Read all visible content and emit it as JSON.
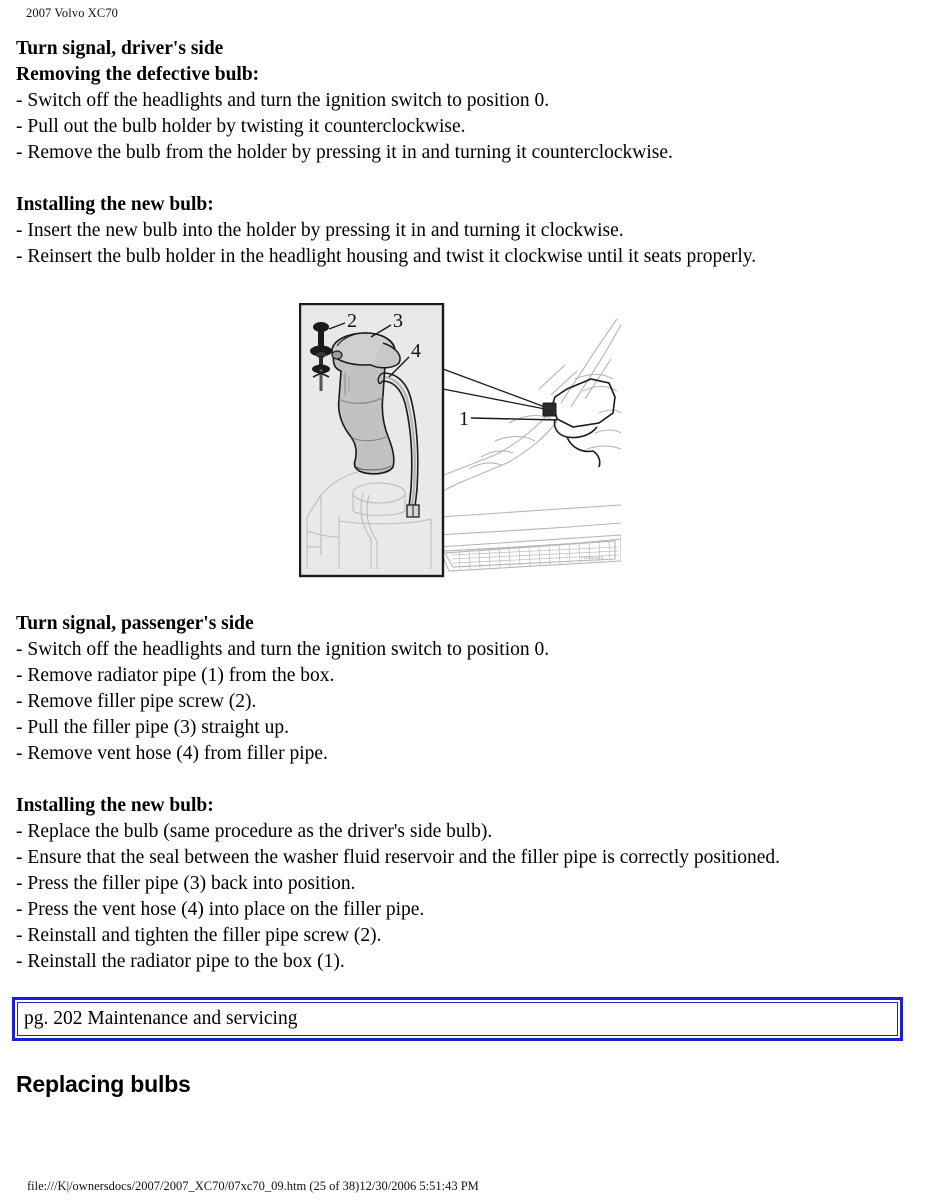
{
  "header": {
    "title": "2007 Volvo XC70"
  },
  "sections": [
    {
      "heading": "Turn signal, driver's side",
      "subheading": "Removing the defective bulb:",
      "items": [
        "- Switch off the headlights and turn the ignition switch to position 0.",
        "- Pull out the bulb holder by twisting it counterclockwise.",
        "- Remove the bulb from the holder by pressing it in and turning it counterclockwise."
      ]
    },
    {
      "heading": "",
      "subheading": "Installing the new bulb:",
      "items": [
        "- Insert the new bulb into the holder by pressing it in and turning it clockwise.",
        "- Reinsert the bulb holder in the headlight housing and twist it clockwise until it seats properly."
      ]
    },
    {
      "heading": "Turn signal, passenger's side",
      "subheading": "",
      "items": [
        "- Switch off the headlights and turn the ignition switch to position 0.",
        "- Remove radiator pipe (1) from the box.",
        "- Remove filler pipe screw (2).",
        "- Pull the filler pipe (3) straight up.",
        "- Remove vent hose (4) from filler pipe."
      ]
    },
    {
      "heading": "",
      "subheading": "Installing the new bulb:",
      "items": [
        "- Replace the bulb (same procedure as the driver's side bulb).",
        "- Ensure that the seal between the washer fluid reservoir and the filler pipe is correctly positioned.",
        "- Press the filler pipe (3) back into position.",
        "- Press the vent hose (4) into place on the filler pipe.",
        "- Reinstall and tighten the filler pipe screw (2).",
        "- Reinstall the radiator pipe to the box (1)."
      ]
    }
  ],
  "figure": {
    "alt": "Washer fluid filler pipe and vent hose detail with vehicle front-end view",
    "callouts": [
      "1",
      "2",
      "3",
      "4"
    ],
    "detail_fill": "#e9e9e9",
    "part_fill": "#c8c8c8",
    "line_color": "#1a1a1a"
  },
  "page_box": {
    "text": "pg. 202 Maintenance and servicing",
    "border_color": "#2020c8"
  },
  "section_heading": "Replacing bulbs",
  "footer": {
    "path": "file:///K|/ownersdocs/2007/2007_XC70/07xc70_09.htm (25 of 38)12/30/2006 5:51:43 PM"
  }
}
